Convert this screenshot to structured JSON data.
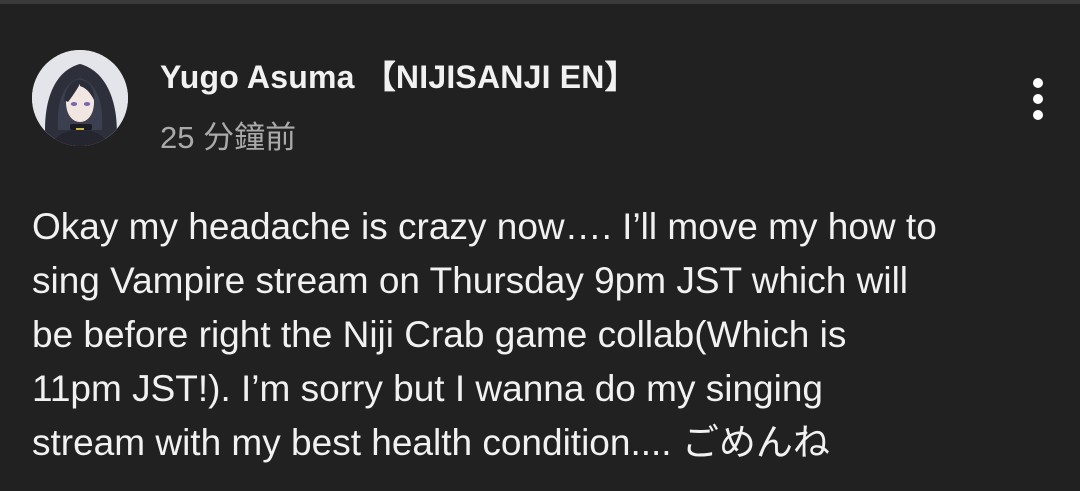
{
  "post": {
    "author": {
      "name": "Yugo Asuma 【NIJISANJI EN】",
      "avatar_icon": "channel-avatar"
    },
    "timestamp": "25 分鐘前",
    "menu_icon": "more-vertical-icon",
    "body_lines": [
      "Okay my headache is crazy now…. I’ll move my how to",
      "sing Vampire stream on Thursday 9pm JST which will",
      "be before right the Niji Crab game collab(Which is",
      "11pm JST!). I’m sorry but I wanna do my singing",
      "stream with my best health condition.... ごめんね"
    ]
  },
  "colors": {
    "background": "#212121",
    "primary_text": "#f1f1f1",
    "secondary_text": "#aaaaaa"
  }
}
